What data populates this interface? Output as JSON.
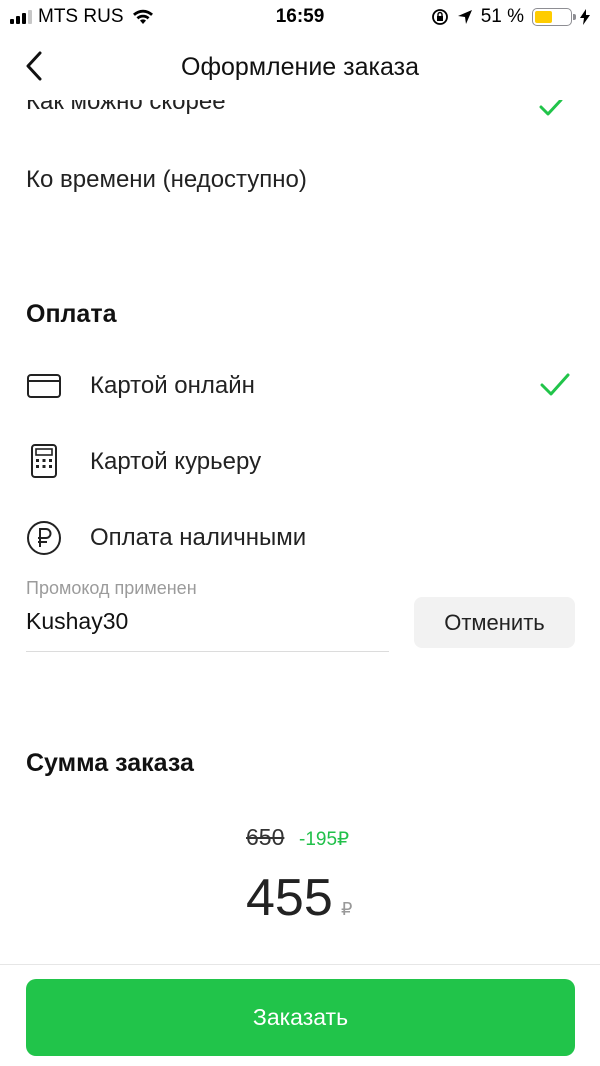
{
  "status_bar": {
    "carrier": "MTS RUS",
    "time": "16:59",
    "battery_percent": "51 %",
    "battery_level": 0.51
  },
  "header": {
    "title": "Оформление заказа"
  },
  "delivery": {
    "asap_label": "Как можно скорее",
    "scheduled_label": "Ко времени (недоступно)"
  },
  "payment": {
    "title": "Оплата",
    "options": [
      {
        "label": "Картой онлайн",
        "icon": "credit-card-icon",
        "selected": true
      },
      {
        "label": "Картой курьеру",
        "icon": "card-terminal-icon",
        "selected": false
      },
      {
        "label": "Оплата наличными",
        "icon": "ruble-coin-icon",
        "selected": false
      }
    ]
  },
  "promo": {
    "caption": "Промокод применен",
    "value": "Kushay30",
    "cancel_label": "Отменить"
  },
  "summary": {
    "title": "Сумма заказа",
    "old_price": "650",
    "discount": "-195₽",
    "total": "455",
    "currency": "₽"
  },
  "order_button_label": "Заказать",
  "colors": {
    "accent": "#21c44a",
    "text": "#222222",
    "muted": "#9b9b9b"
  }
}
